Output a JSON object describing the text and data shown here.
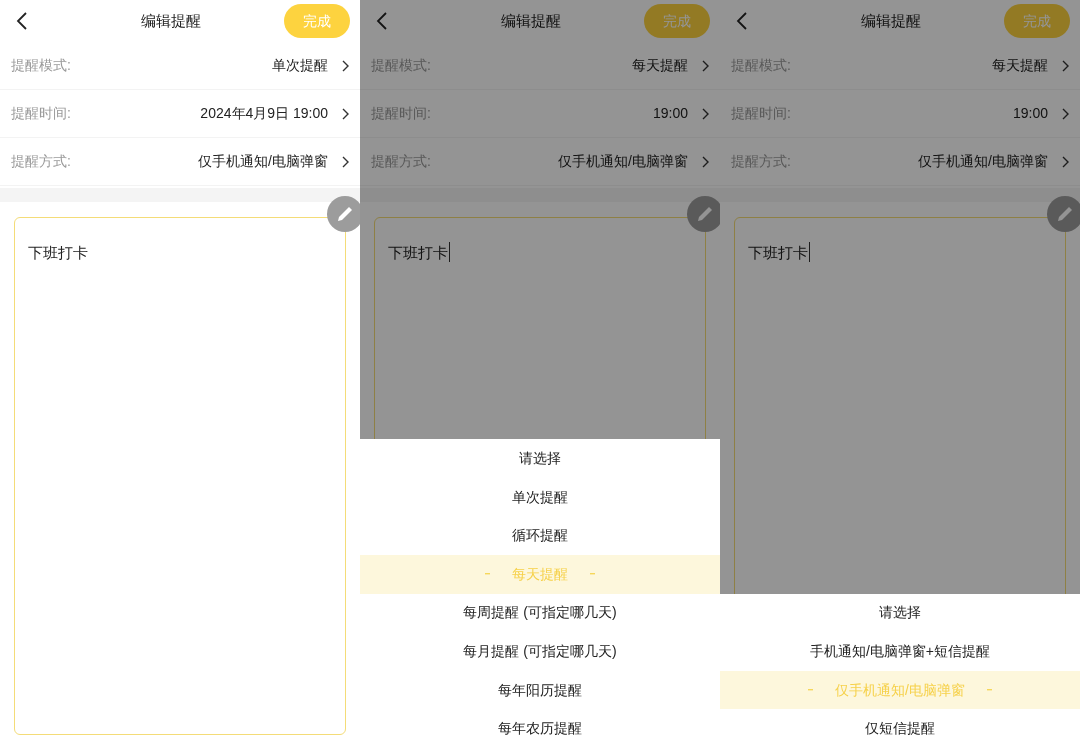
{
  "screens": [
    {
      "title": "编辑提醒",
      "done_button": "完成",
      "rows": [
        {
          "label": "提醒模式:",
          "value": "单次提醒"
        },
        {
          "label": "提醒时间:",
          "value": "2024年4月9日 19:00"
        },
        {
          "label": "提醒方式:",
          "value": "仅手机通知/电脑弹窗"
        }
      ],
      "note": {
        "text": "下班打卡",
        "focused": false
      }
    },
    {
      "title": "编辑提醒",
      "done_button": "完成",
      "rows": [
        {
          "label": "提醒模式:",
          "value": "每天提醒"
        },
        {
          "label": "提醒时间:",
          "value": "19:00"
        },
        {
          "label": "提醒方式:",
          "value": "仅手机通知/电脑弹窗"
        }
      ],
      "note": {
        "text": "下班打卡",
        "focused": true
      },
      "picker": {
        "options": [
          {
            "label": "请选择",
            "selected": false
          },
          {
            "label": "单次提醒",
            "selected": false
          },
          {
            "label": "循环提醒",
            "selected": false
          },
          {
            "label": "每天提醒",
            "selected": true
          },
          {
            "label": "每周提醒 (可指定哪几天)",
            "selected": false
          },
          {
            "label": "每月提醒 (可指定哪几天)",
            "selected": false
          },
          {
            "label": "每年阳历提醒",
            "selected": false
          },
          {
            "label": "每年农历提醒",
            "selected": false
          }
        ]
      }
    },
    {
      "title": "编辑提醒",
      "done_button": "完成",
      "rows": [
        {
          "label": "提醒模式:",
          "value": "每天提醒"
        },
        {
          "label": "提醒时间:",
          "value": "19:00"
        },
        {
          "label": "提醒方式:",
          "value": "仅手机通知/电脑弹窗"
        }
      ],
      "note": {
        "text": "下班打卡",
        "focused": true
      },
      "picker": {
        "options": [
          {
            "label": "请选择",
            "selected": false
          },
          {
            "label": "手机通知/电脑弹窗+短信提醒",
            "selected": false
          },
          {
            "label": "仅手机通知/电脑弹窗",
            "selected": true
          },
          {
            "label": "仅短信提醒",
            "selected": false
          }
        ]
      }
    }
  ]
}
